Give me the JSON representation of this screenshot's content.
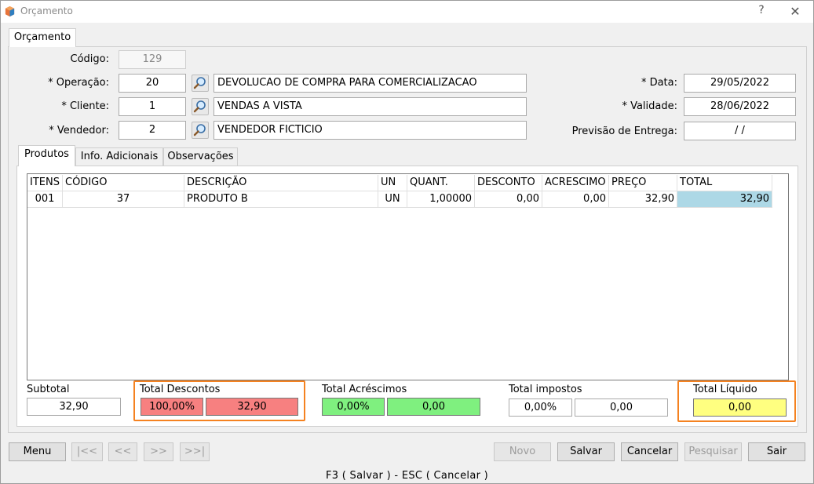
{
  "window": {
    "title": "Orçamento",
    "help": "?",
    "close": "✕"
  },
  "main_tab": "Orçamento",
  "form": {
    "codigo_label": "Código:",
    "codigo_value": "129",
    "operacao_label": "* Operação:",
    "operacao_code": "20",
    "operacao_desc": "DEVOLUCAO DE COMPRA PARA COMERCIALIZACAO",
    "cliente_label": "* Cliente:",
    "cliente_code": "1",
    "cliente_desc": "VENDAS A VISTA",
    "vendedor_label": "* Vendedor:",
    "vendedor_code": "2",
    "vendedor_desc": "VENDEDOR FICTICIO",
    "data_label": "* Data:",
    "data_value": "29/05/2022",
    "validade_label": "* Validade:",
    "validade_value": "28/06/2022",
    "previsao_label": "Previsão de Entrega:",
    "previsao_value": "/  /"
  },
  "sub_tabs": [
    "Produtos",
    "Info. Adicionais",
    "Observações"
  ],
  "grid": {
    "columns": [
      "ITENS",
      "CÓDIGO",
      "DESCRIÇÃO",
      "UN",
      "QUANT.",
      "DESCONTO",
      "ACRESCIMO",
      "PREÇO",
      "TOTAL"
    ],
    "rows": [
      [
        "001",
        "37",
        "PRODUTO B",
        "UN",
        "1,00000",
        "0,00",
        "0,00",
        "32,90",
        "32,90"
      ]
    ]
  },
  "totals": {
    "subtotal_label": "Subtotal",
    "subtotal_value": "32,90",
    "descontos_label": "Total Descontos",
    "descontos_pct": "100,00%",
    "descontos_value": "32,90",
    "acrescimos_label": "Total Acréscimos",
    "acrescimos_pct": "0,00%",
    "acrescimos_value": "0,00",
    "impostos_label": "Total impostos",
    "impostos_pct": "0,00%",
    "impostos_value": "0,00",
    "liquido_label": "Total Líquido",
    "liquido_value": "0,00"
  },
  "buttons": {
    "menu": "Menu",
    "first": "|<<",
    "prev": "<<",
    "next": ">>",
    "last": ">>|",
    "novo": "Novo",
    "salvar": "Salvar",
    "cancelar": "Cancelar",
    "pesquisar": "Pesquisar",
    "sair": "Sair"
  },
  "status_bar": "F3 ( Salvar )  -  ESC ( Cancelar )",
  "colors": {
    "discount_red": "#f78080",
    "addition_green": "#7ff07f",
    "net_yellow": "#ffff80",
    "selected_cell": "#add8e6",
    "highlight_orange": "#f58220"
  }
}
